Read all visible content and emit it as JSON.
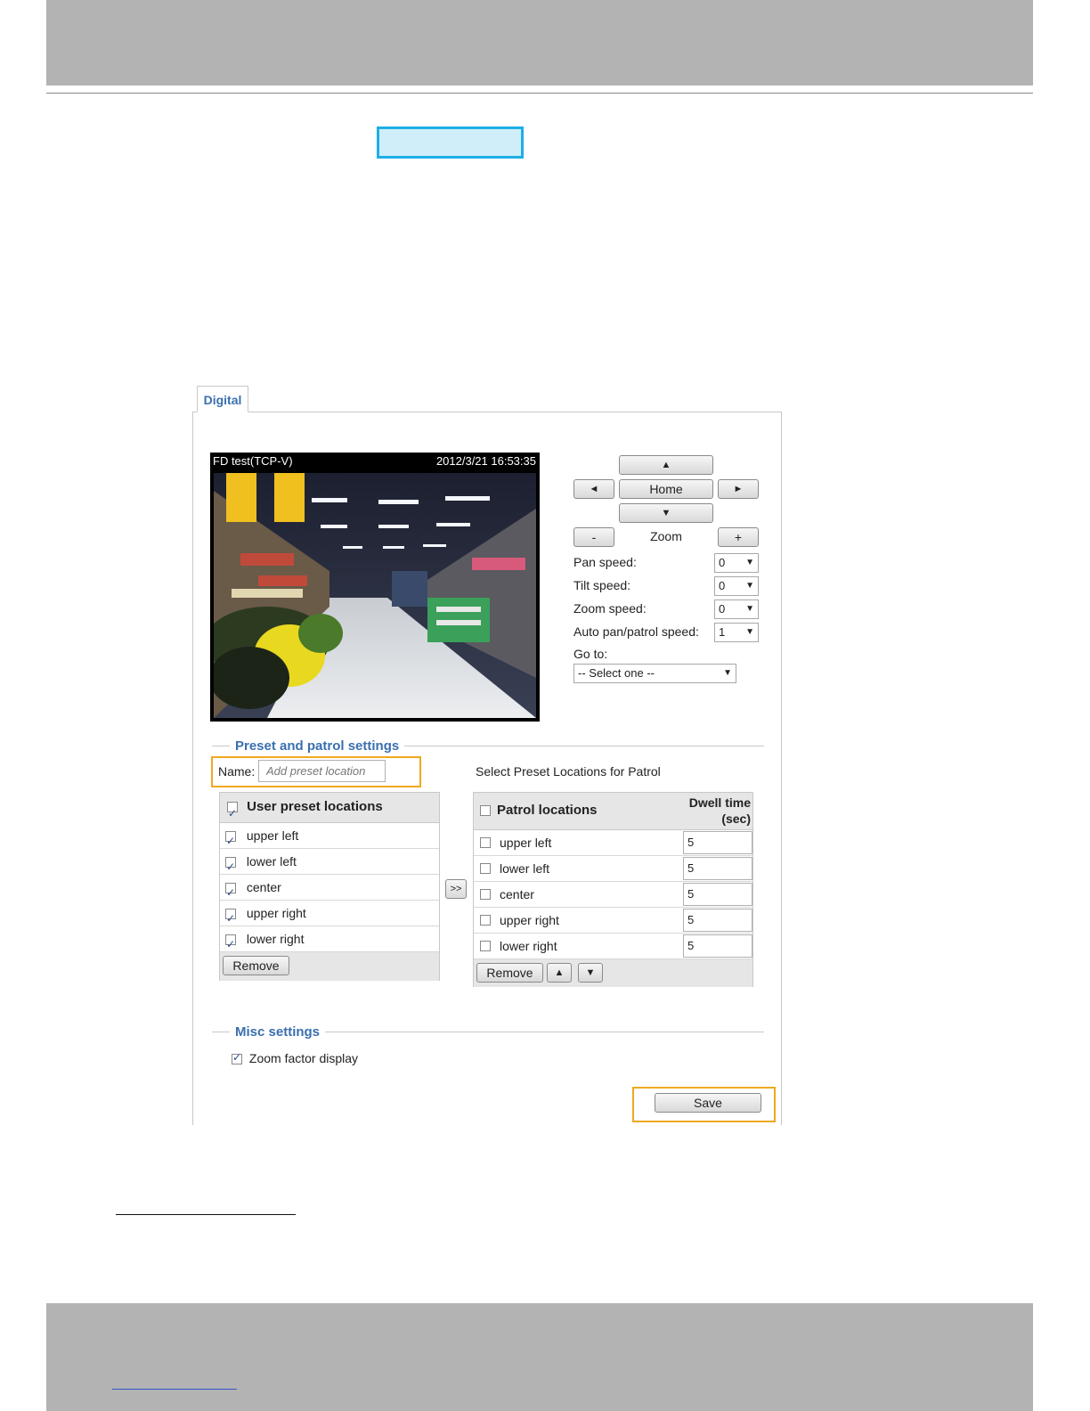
{
  "panel": {
    "tab_label": "Digital"
  },
  "video": {
    "name": "FD test(TCP-V)",
    "timestamp": "2012/3/21 16:53:35"
  },
  "ptz": {
    "up": "▲",
    "down": "▼",
    "left": "◄",
    "right": "►",
    "home": "Home",
    "zoom_label": "Zoom",
    "zoom_out": "-",
    "zoom_in": "+",
    "pan_speed": {
      "label": "Pan speed:",
      "value": "0"
    },
    "tilt_speed": {
      "label": "Tilt speed:",
      "value": "0"
    },
    "zoom_speed": {
      "label": "Zoom speed:",
      "value": "0"
    },
    "auto_speed": {
      "label": "Auto pan/patrol speed:",
      "value": "1"
    },
    "goto": {
      "label": "Go to:",
      "value": "-- Select one --"
    }
  },
  "preset": {
    "legend": "Preset and patrol settings",
    "name_label": "Name:",
    "name_placeholder": "Add preset location",
    "patrol_heading": "Select Preset Locations for Patrol",
    "user_header": "User preset locations",
    "user_items": [
      {
        "label": "upper left",
        "checked": true
      },
      {
        "label": "lower left",
        "checked": true
      },
      {
        "label": "center",
        "checked": true
      },
      {
        "label": "upper right",
        "checked": true
      },
      {
        "label": "lower right",
        "checked": true
      }
    ],
    "remove_label": "Remove",
    "move_label": ">>",
    "patrol_header": "Patrol locations",
    "dwell_header_line1": "Dwell time",
    "dwell_header_line2": "(sec)",
    "patrol_items": [
      {
        "label": "upper left",
        "dwell": "5"
      },
      {
        "label": "lower left",
        "dwell": "5"
      },
      {
        "label": "center",
        "dwell": "5"
      },
      {
        "label": "upper right",
        "dwell": "5"
      },
      {
        "label": "lower right",
        "dwell": "5"
      }
    ],
    "patrol_remove_label": "Remove",
    "up_label": "▲",
    "down_label": "▼"
  },
  "misc": {
    "legend": "Misc settings",
    "zoom_factor_label": "Zoom factor display"
  },
  "save_label": "Save",
  "colors": {
    "legend_blue": "#3a6fb0",
    "highlight_blue": "#1eaee6",
    "orange": "#f0a820",
    "gray_bar": "#b3b3b3"
  }
}
